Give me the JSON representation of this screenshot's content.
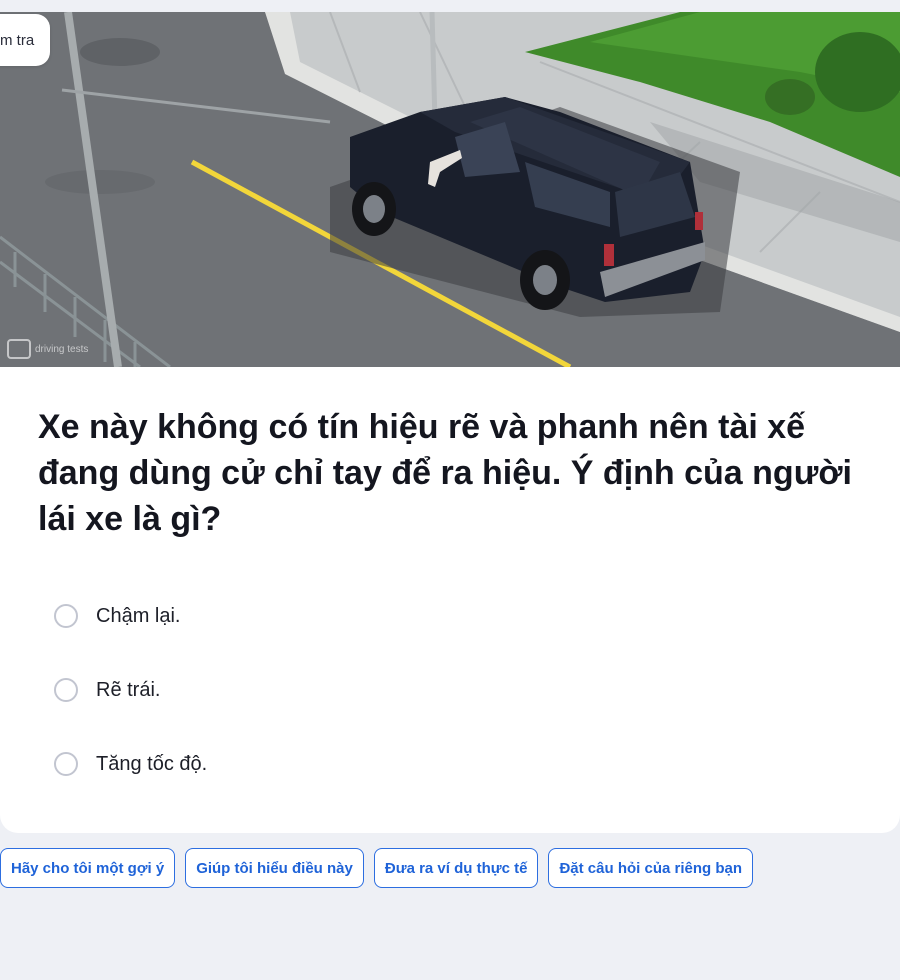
{
  "quiz": {
    "tag_label": "m tra",
    "watermark": "driving tests",
    "question": "Xe này không có tín hiệu rẽ và phanh nên tài xế đang dùng cử chỉ tay để ra hiệu. Ý định của người lái xe là gì?",
    "options": [
      {
        "label": "Chậm lại."
      },
      {
        "label": "Rẽ trái."
      },
      {
        "label": "Tăng tốc độ."
      }
    ]
  },
  "help_chips": [
    {
      "label": "Hãy cho tôi một gợi ý"
    },
    {
      "label": "Giúp tôi hiểu điều này"
    },
    {
      "label": "Đưa ra ví dụ thực tế"
    },
    {
      "label": "Đặt câu hỏi của riêng bạn"
    }
  ],
  "colors": {
    "page_background": "#eef0f5",
    "chip_accent": "#1f63d8",
    "road_line": "#f2d63a",
    "grass": "#3f8a2a",
    "car_body": "#1a1f2c"
  }
}
